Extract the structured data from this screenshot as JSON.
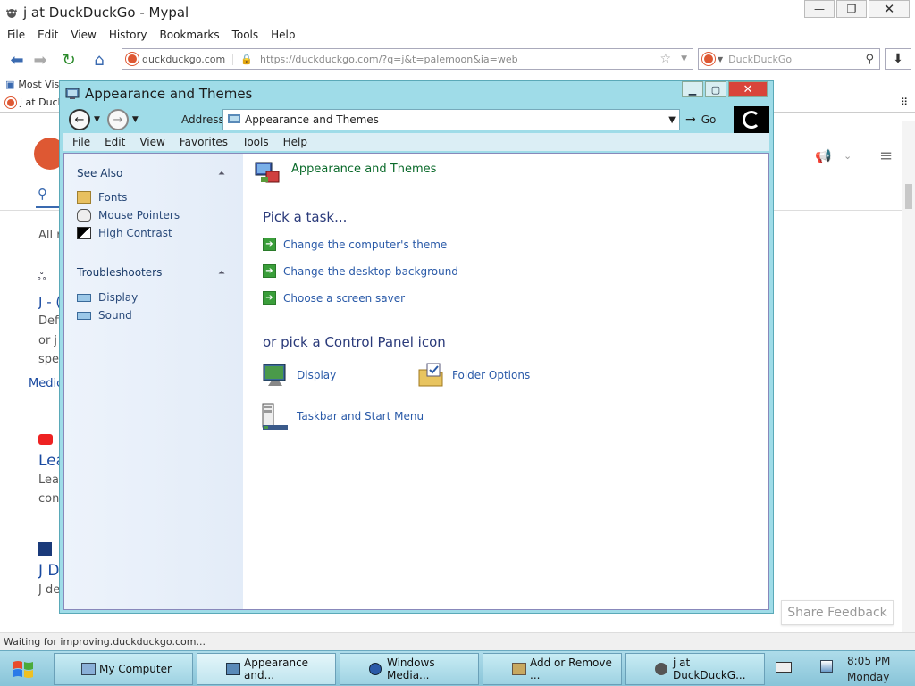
{
  "browser": {
    "title": "j at DuckDuckGo - Mypal",
    "menu": [
      "File",
      "Edit",
      "View",
      "History",
      "Bookmarks",
      "Tools",
      "Help"
    ],
    "url_site": "duckduckgo.com",
    "url": "https://duckduckgo.com/?q=j&t=palemoon&ia=web",
    "search_placeholder": "DuckDuckGo",
    "bookmark": "Most Vis",
    "tab": "j at Duck",
    "status": "Waiting for improving.duckduckgo.com...",
    "share_feedback": "Share Feedback",
    "page_fragments": {
      "all": "All r",
      "j_first": "J - (",
      "def": "Defi",
      "orj": "or j",
      "spe": "spe",
      "medic": "Medic",
      "lea": "Lea",
      "lea2": "Lea",
      "con": "con",
      "jd": "J D",
      "jde": "J de"
    }
  },
  "explorer": {
    "title": "Appearance and Themes",
    "address_label": "Address",
    "address_value": "Appearance and Themes",
    "go_label": "Go",
    "menu": [
      "File",
      "Edit",
      "View",
      "Favorites",
      "Tools",
      "Help"
    ],
    "sidebar": {
      "see_also": {
        "title": "See Also",
        "items": [
          "Fonts",
          "Mouse Pointers",
          "High Contrast"
        ]
      },
      "troubleshooters": {
        "title": "Troubleshooters",
        "items": [
          "Display",
          "Sound"
        ]
      }
    },
    "content": {
      "category_title": "Appearance and Themes",
      "pick_task": "Pick a task...",
      "tasks": [
        "Change the computer's theme",
        "Change the desktop background",
        "Choose a screen saver"
      ],
      "or_pick": "or pick a Control Panel icon",
      "icons": [
        "Display",
        "Folder Options",
        "Taskbar and Start Menu"
      ]
    }
  },
  "taskbar": {
    "buttons": [
      "My Computer",
      "Appearance and...",
      "Windows Media...",
      "Add or Remove ...",
      "j at DuckDuckG..."
    ],
    "time": "8:05 PM",
    "day": "Monday"
  },
  "colors": {
    "explorer_frame": "#9fdce8",
    "link_blue": "#2a5aa8",
    "category_green": "#0a6a2a",
    "close_red": "#d9443a"
  }
}
